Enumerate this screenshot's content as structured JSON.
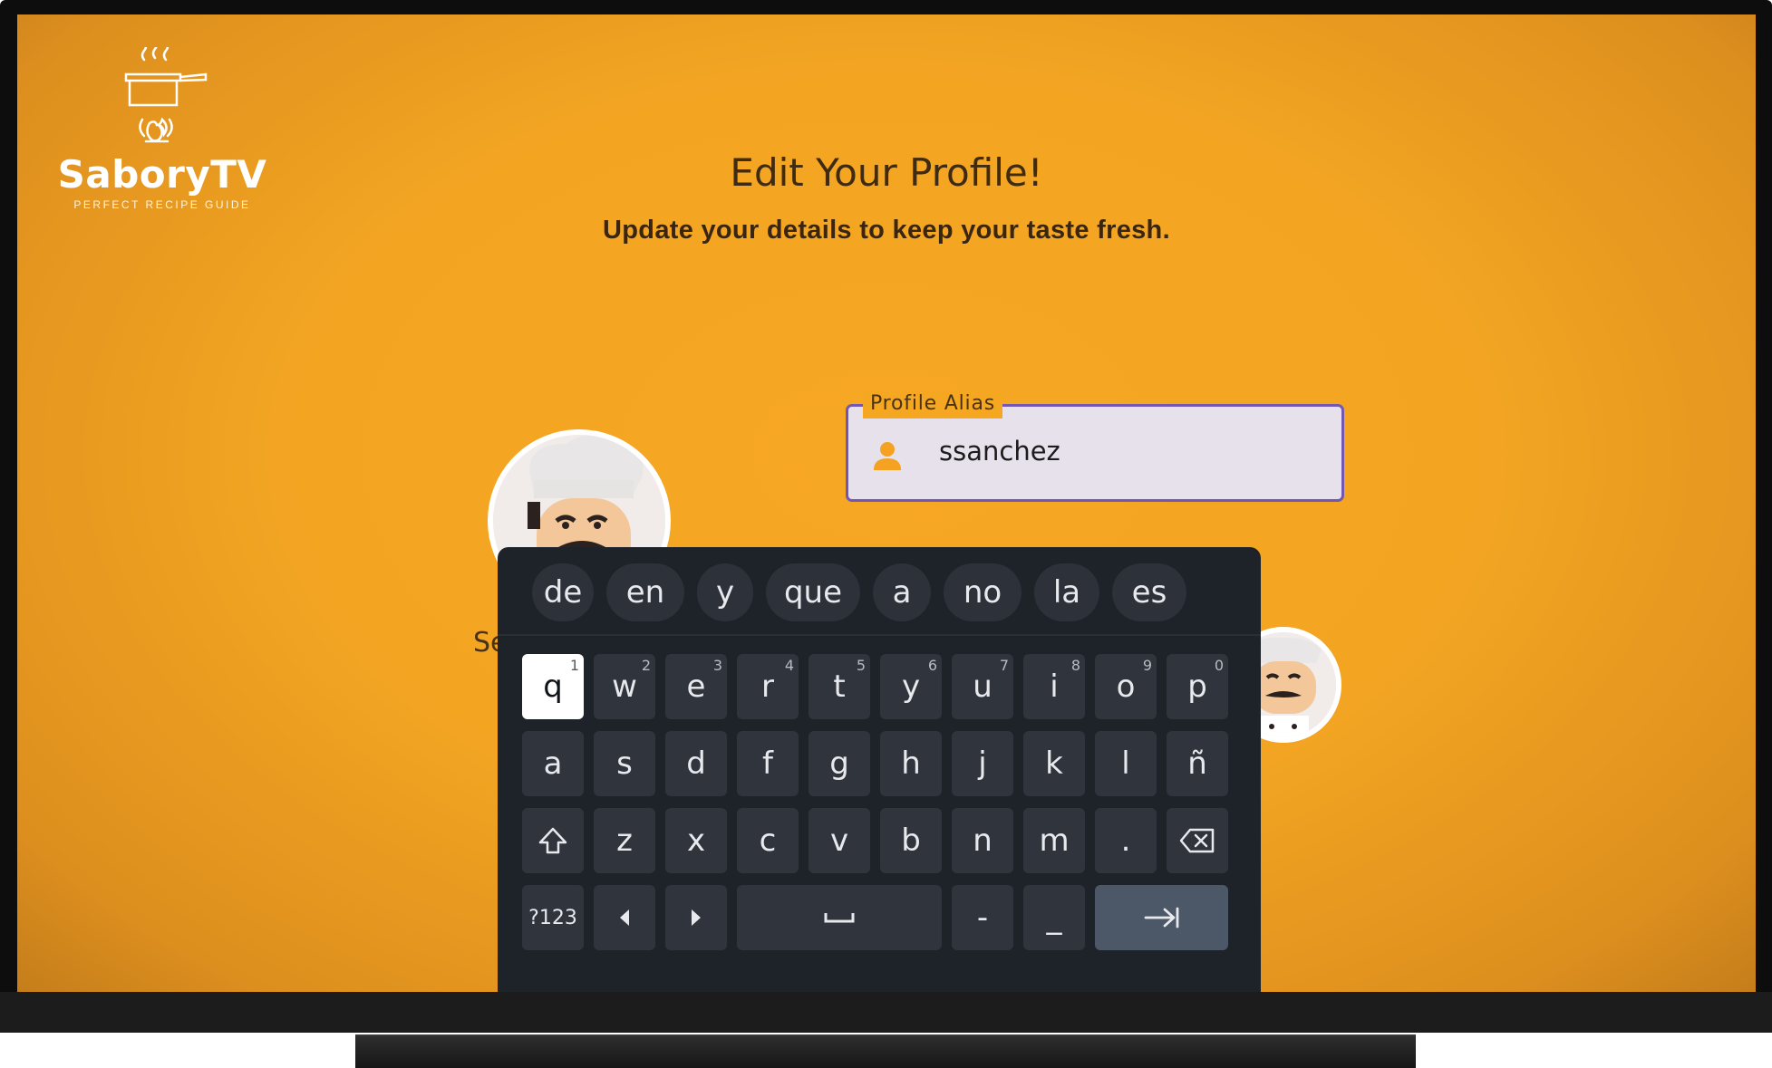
{
  "app": {
    "logo_title": "SaboryTV",
    "logo_subtitle": "PERFECT RECIPE GUIDE",
    "logo_icon": "cooking-pot-icon",
    "accent_color": "#f5a623"
  },
  "page": {
    "title": "Edit Your Profile!",
    "subtitle": "Update your details to keep your taste fresh."
  },
  "profile_field": {
    "label": "Profile Alias",
    "value": "ssanchez",
    "icon": "person-icon",
    "border_color": "#7257b3"
  },
  "avatars": {
    "partially_hidden_label": "Se"
  },
  "keyboard": {
    "suggestions": [
      "de",
      "en",
      "y",
      "que",
      "a",
      "no",
      "la",
      "es"
    ],
    "row1": [
      {
        "label": "q",
        "num": "1"
      },
      {
        "label": "w",
        "num": "2"
      },
      {
        "label": "e",
        "num": "3"
      },
      {
        "label": "r",
        "num": "4"
      },
      {
        "label": "t",
        "num": "5"
      },
      {
        "label": "y",
        "num": "6"
      },
      {
        "label": "u",
        "num": "7"
      },
      {
        "label": "i",
        "num": "8"
      },
      {
        "label": "o",
        "num": "9"
      },
      {
        "label": "p",
        "num": "0"
      }
    ],
    "row2": [
      "a",
      "s",
      "d",
      "f",
      "g",
      "h",
      "j",
      "k",
      "l",
      "ñ"
    ],
    "row3": [
      "z",
      "x",
      "c",
      "v",
      "b",
      "n",
      "m",
      "."
    ],
    "row4": {
      "symbols_label": "?123",
      "dash": "-",
      "underscore": "_"
    },
    "focused_key": "q"
  }
}
